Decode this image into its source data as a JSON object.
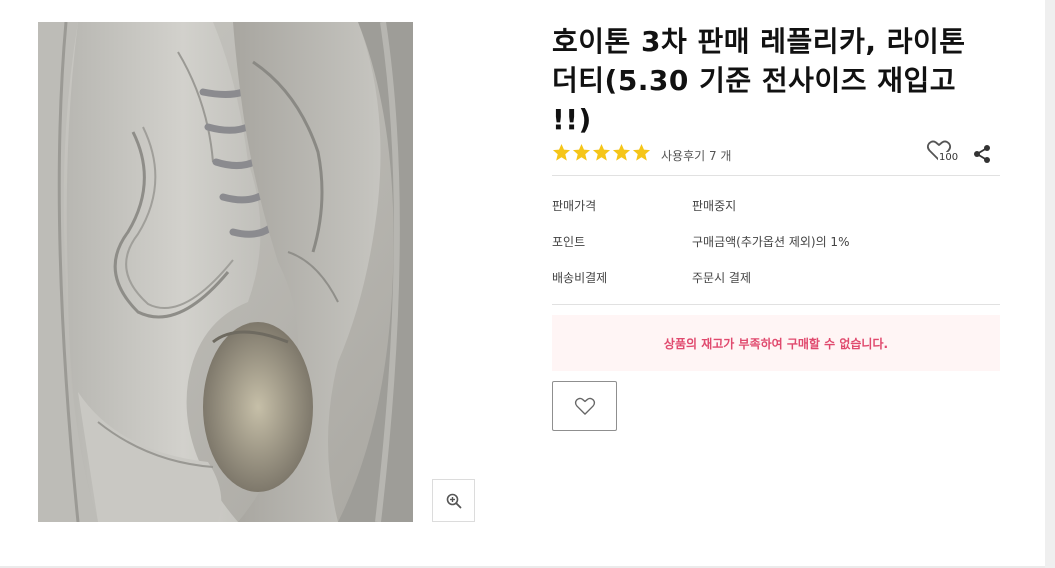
{
  "product": {
    "title_line1": "호이톤 3차 판매 레플리카, 라이톤",
    "title_line2": "더티(5.30 기준 전사이즈 재입고",
    "title_line3": "!!)",
    "image_alt": "Dirty white leather sneakers close-up"
  },
  "rating": {
    "stars": 5,
    "max_stars": 5,
    "review_text": "사용후기 7 개",
    "star_color": "#f5c518"
  },
  "actions": {
    "like_count": "100",
    "share_icon": "share-icon",
    "like_icon": "heart-outline-icon",
    "zoom_icon": "zoom-in-icon"
  },
  "specs": [
    {
      "label": "판매가격",
      "value": "판매중지"
    },
    {
      "label": "포인트",
      "value": "구매금액(추가옵션 제외)의 1%"
    },
    {
      "label": "배송비결제",
      "value": "주문시 결제"
    }
  ],
  "notice": {
    "soldout_message": "상품의 재고가 부족하여 구매할 수 없습니다.",
    "color": "#e04a6e"
  },
  "wishlist_icon": "heart-outline-icon"
}
